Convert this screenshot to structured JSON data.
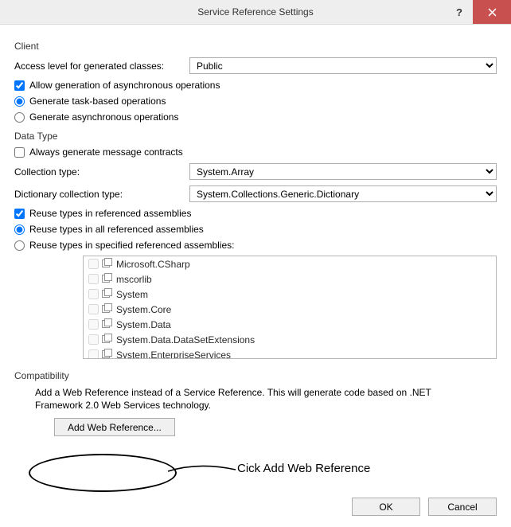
{
  "window": {
    "title": "Service Reference Settings"
  },
  "client": {
    "group": "Client",
    "access_level_label": "Access level for generated classes:",
    "access_level_value": "Public",
    "allow_async_label": "Allow generation of asynchronous operations",
    "allow_async_checked": true,
    "gen_task_label": "Generate task-based operations",
    "gen_async_label": "Generate asynchronous operations"
  },
  "datatype": {
    "group": "Data Type",
    "always_contracts_label": "Always generate message contracts",
    "always_contracts_checked": false,
    "collection_type_label": "Collection type:",
    "collection_type_value": "System.Array",
    "dict_type_label": "Dictionary collection type:",
    "dict_type_value": "System.Collections.Generic.Dictionary",
    "reuse_label": "Reuse types in referenced assemblies",
    "reuse_checked": true,
    "reuse_all_label": "Reuse types in all referenced assemblies",
    "reuse_specified_label": "Reuse types in specified referenced assemblies:",
    "assemblies": [
      "Microsoft.CSharp",
      "mscorlib",
      "System",
      "System.Core",
      "System.Data",
      "System.Data.DataSetExtensions",
      "System.EnterpriseServices"
    ]
  },
  "compat": {
    "group": "Compatibility",
    "text": "Add a Web Reference instead of a Service Reference. This will generate code based on .NET Framework 2.0 Web Services technology.",
    "add_web_ref": "Add Web Reference..."
  },
  "buttons": {
    "ok": "OK",
    "cancel": "Cancel"
  },
  "annotation": {
    "text": "Cick Add Web Reference"
  }
}
